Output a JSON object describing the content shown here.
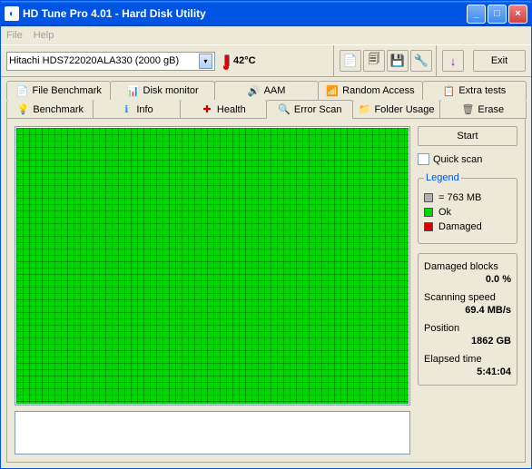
{
  "window": {
    "title": "HD Tune Pro 4.01 - Hard Disk Utility"
  },
  "menu": {
    "file": "File",
    "help": "Help"
  },
  "toolbar": {
    "drive": "Hitachi HDS722020ALA330 (2000 gB)",
    "temp": "42°C",
    "exit": "Exit"
  },
  "tabs_top": [
    {
      "label": "File Benchmark",
      "icon": "📄",
      "color": "#1e90ff"
    },
    {
      "label": "Disk monitor",
      "icon": "📊",
      "color": "#2e8b57"
    },
    {
      "label": "AAM",
      "icon": "🔊",
      "color": "#daa520"
    },
    {
      "label": "Random Access",
      "icon": "📶",
      "color": "#8b4513"
    },
    {
      "label": "Extra tests",
      "icon": "📋",
      "color": "#4169e1"
    }
  ],
  "tabs_bottom": [
    {
      "label": "Benchmark",
      "icon": "💡",
      "color": "#ffd700"
    },
    {
      "label": "Info",
      "icon": "ℹ",
      "color": "#1e90ff"
    },
    {
      "label": "Health",
      "icon": "✚",
      "color": "#d00000"
    },
    {
      "label": "Error Scan",
      "icon": "🔍",
      "color": "#2e8b57",
      "active": true
    },
    {
      "label": "Folder Usage",
      "icon": "📁",
      "color": "#daa520"
    },
    {
      "label": "Erase",
      "icon": "🗑",
      "color": "#555"
    }
  ],
  "side": {
    "start": "Start",
    "quick_scan": "Quick scan",
    "legend_title": "Legend",
    "legend_block": "= 763 MB",
    "legend_ok": "Ok",
    "legend_damaged": "Damaged",
    "damaged_lbl": "Damaged blocks",
    "damaged_val": "0.0 %",
    "speed_lbl": "Scanning speed",
    "speed_val": "69.4 MB/s",
    "pos_lbl": "Position",
    "pos_val": "1862 GB",
    "elapsed_lbl": "Elapsed time",
    "elapsed_val": "5:41:04"
  }
}
